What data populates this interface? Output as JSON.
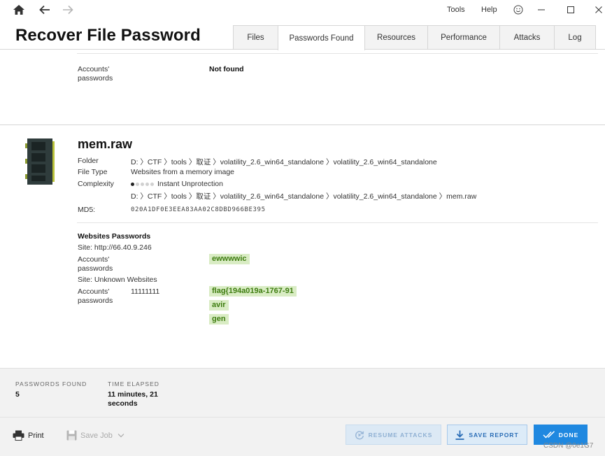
{
  "titlebar": {
    "menu": {
      "tools": "Tools",
      "help": "Help"
    },
    "icons": [
      "home-icon",
      "back-arrow-icon",
      "forward-arrow-icon",
      "smiley-icon",
      "minimize-icon",
      "maximize-icon",
      "close-icon"
    ]
  },
  "app": {
    "title": "Recover File Password"
  },
  "tabs": [
    "Files",
    "Passwords Found",
    "Resources",
    "Performance",
    "Attacks",
    "Log"
  ],
  "active_tab": "Passwords Found",
  "prev_entry": {
    "accounts_label": "Accounts'\npasswords",
    "accounts_value": "Not found"
  },
  "file": {
    "name": "mem.raw",
    "folder_label": "Folder",
    "folder_value": "D: 〉CTF 〉tools 〉取证 〉volatility_2.6_win64_standalone 〉volatility_2.6_win64_standalone",
    "filetype_label": "File Type",
    "filetype_value": "Websites from a memory image",
    "complexity_label": "Complexity",
    "complexity_value": "Instant Unprotection",
    "complexity_level": 1,
    "complexity_max": 5,
    "path_value": "D: 〉CTF 〉tools 〉取证 〉volatility_2.6_win64_standalone 〉volatility_2.6_win64_standalone 〉mem.raw",
    "md5_label": "MD5:",
    "md5_value": "020A1DF0E3EEA83AA02C8DBD966BE395"
  },
  "websites": {
    "heading": "Websites Passwords",
    "sites": [
      {
        "site": "Site: http://66.40.9.246",
        "accounts_label": "Accounts'\npasswords",
        "account": "",
        "passwords": [
          "ewwwwic"
        ]
      },
      {
        "site": "Site: Unknown Websites",
        "accounts_label": "Accounts'\npasswords",
        "account": "11111111",
        "passwords": [
          "flag{194a019a-1767-91",
          "avir",
          "gen"
        ]
      }
    ]
  },
  "stats": {
    "passwords_found_label": "PASSWORDS FOUND",
    "passwords_found_value": "5",
    "time_elapsed_label": "TIME ELAPSED",
    "time_elapsed_value": "11 minutes, 21\nseconds"
  },
  "toolbar": {
    "print": "Print",
    "save_job": "Save Job",
    "resume": "RESUME ATTACKS",
    "save_report": "SAVE REPORT",
    "done": "DONE"
  },
  "watermark": "CSDN @0e1G7",
  "colors": {
    "accent": "#1f88e0",
    "password_bg": "#d9ecc4",
    "password_fg": "#3e7d10"
  }
}
